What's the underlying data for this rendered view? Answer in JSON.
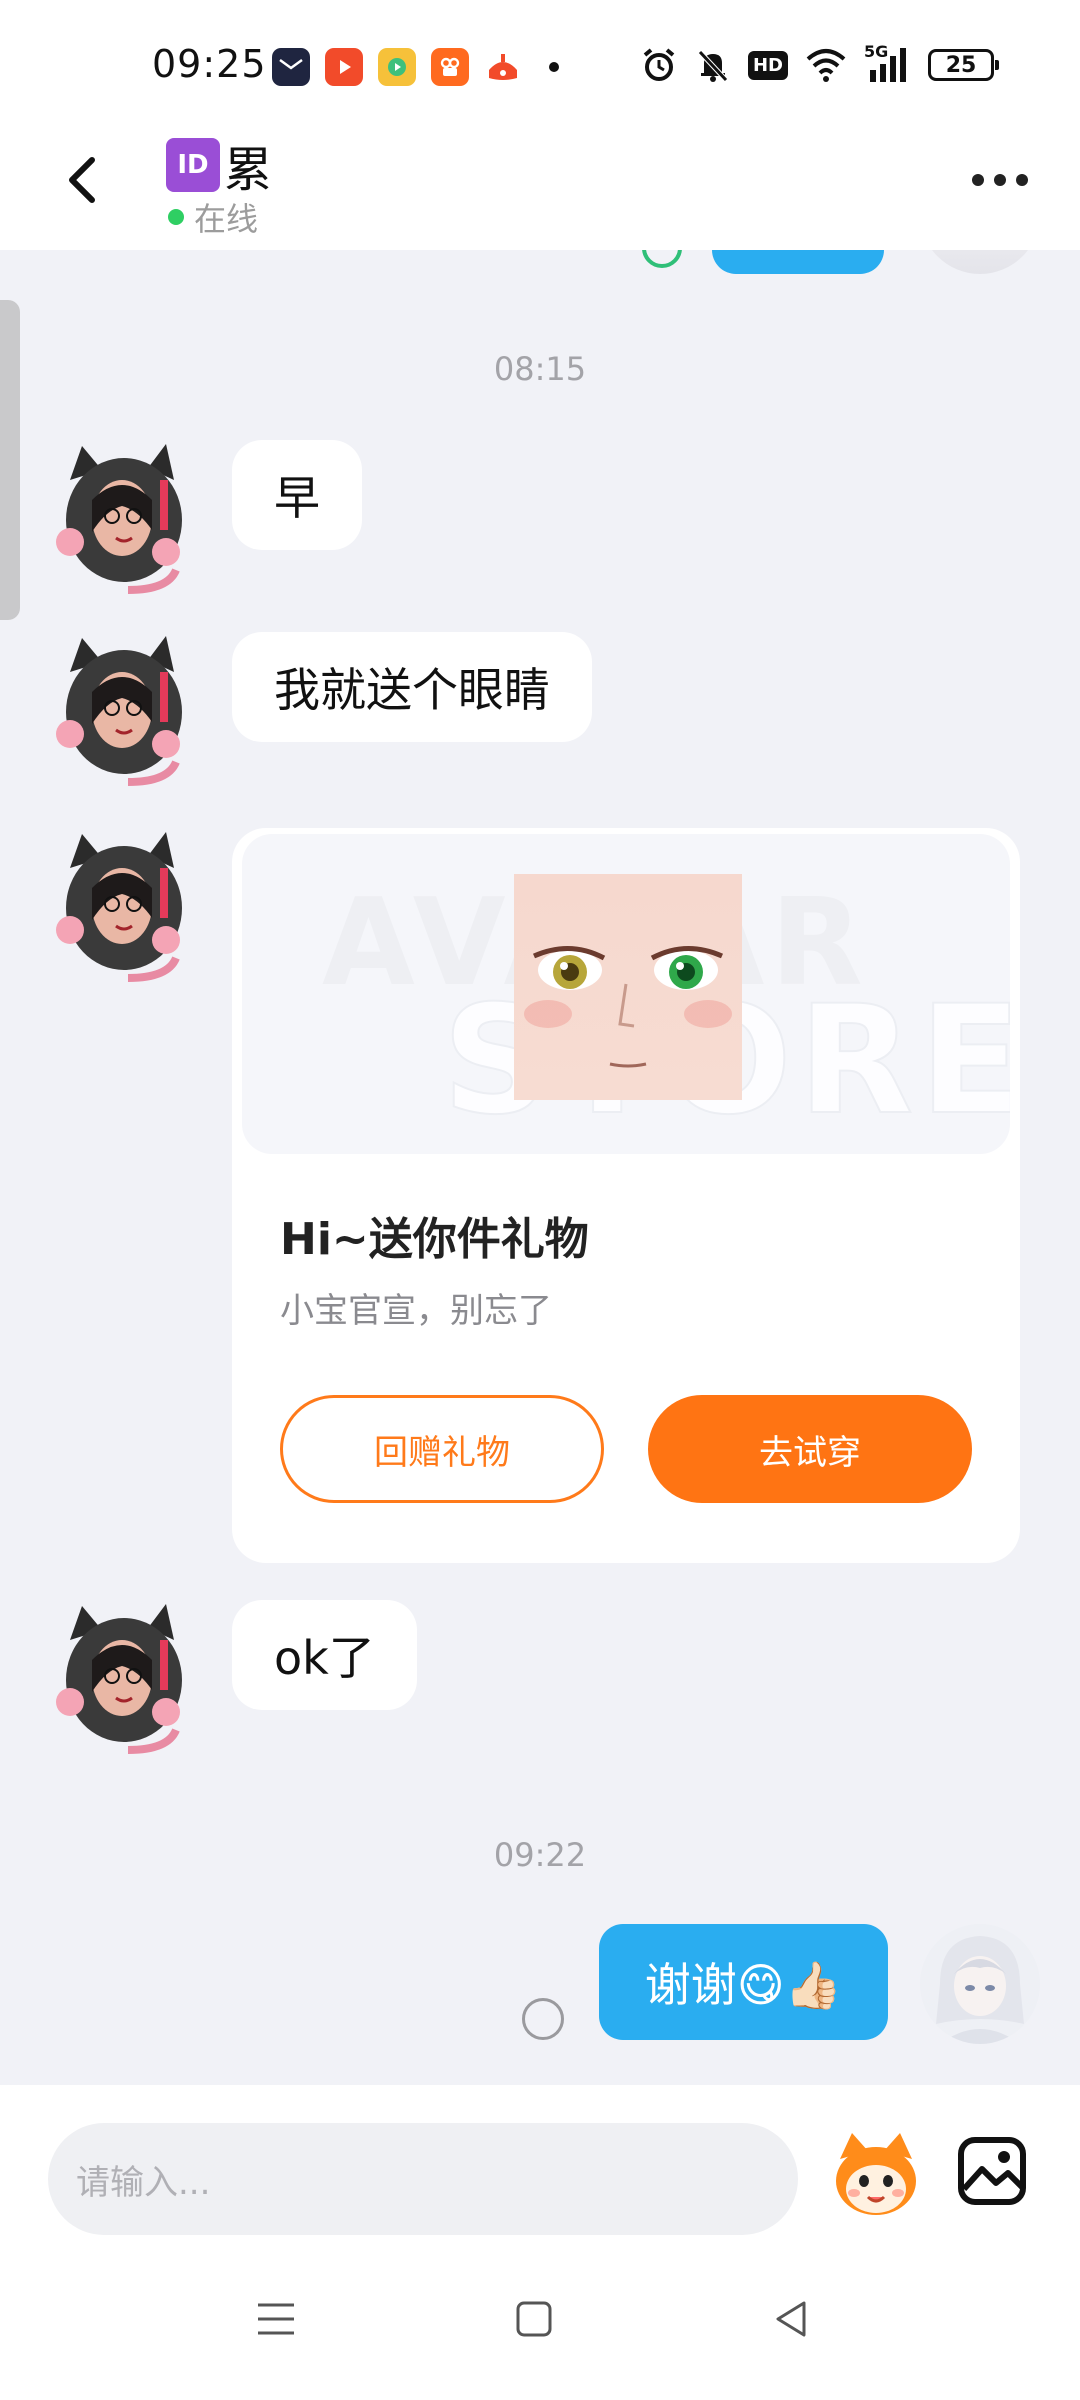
{
  "status_bar": {
    "time": "09:25",
    "network": "5G",
    "hd": "HD",
    "battery": "25"
  },
  "header": {
    "contact_name": "累",
    "contact_badge": "ID",
    "online_status": "在线"
  },
  "chat": {
    "timestamp_1": "08:15",
    "messages": [
      {
        "text": "早"
      },
      {
        "text": "我就送个眼睛"
      },
      {
        "text": "ok了"
      }
    ],
    "gift_card": {
      "title": "Hi~送你件礼物",
      "subtitle": "小宝官宣，别忘了",
      "watermark_line1": "AVATAR",
      "watermark_line2": "STORE",
      "return_gift_label": "回赠礼物",
      "try_on_label": "去试穿"
    },
    "timestamp_2": "09:22",
    "my_message": "谢谢😋👍🏻"
  },
  "input": {
    "placeholder": "请输入..."
  },
  "colors": {
    "accent_orange": "#ff7413",
    "bubble_blue": "#2aadf0",
    "online_green": "#2fcf63",
    "chat_bg": "#f1f2f7"
  }
}
